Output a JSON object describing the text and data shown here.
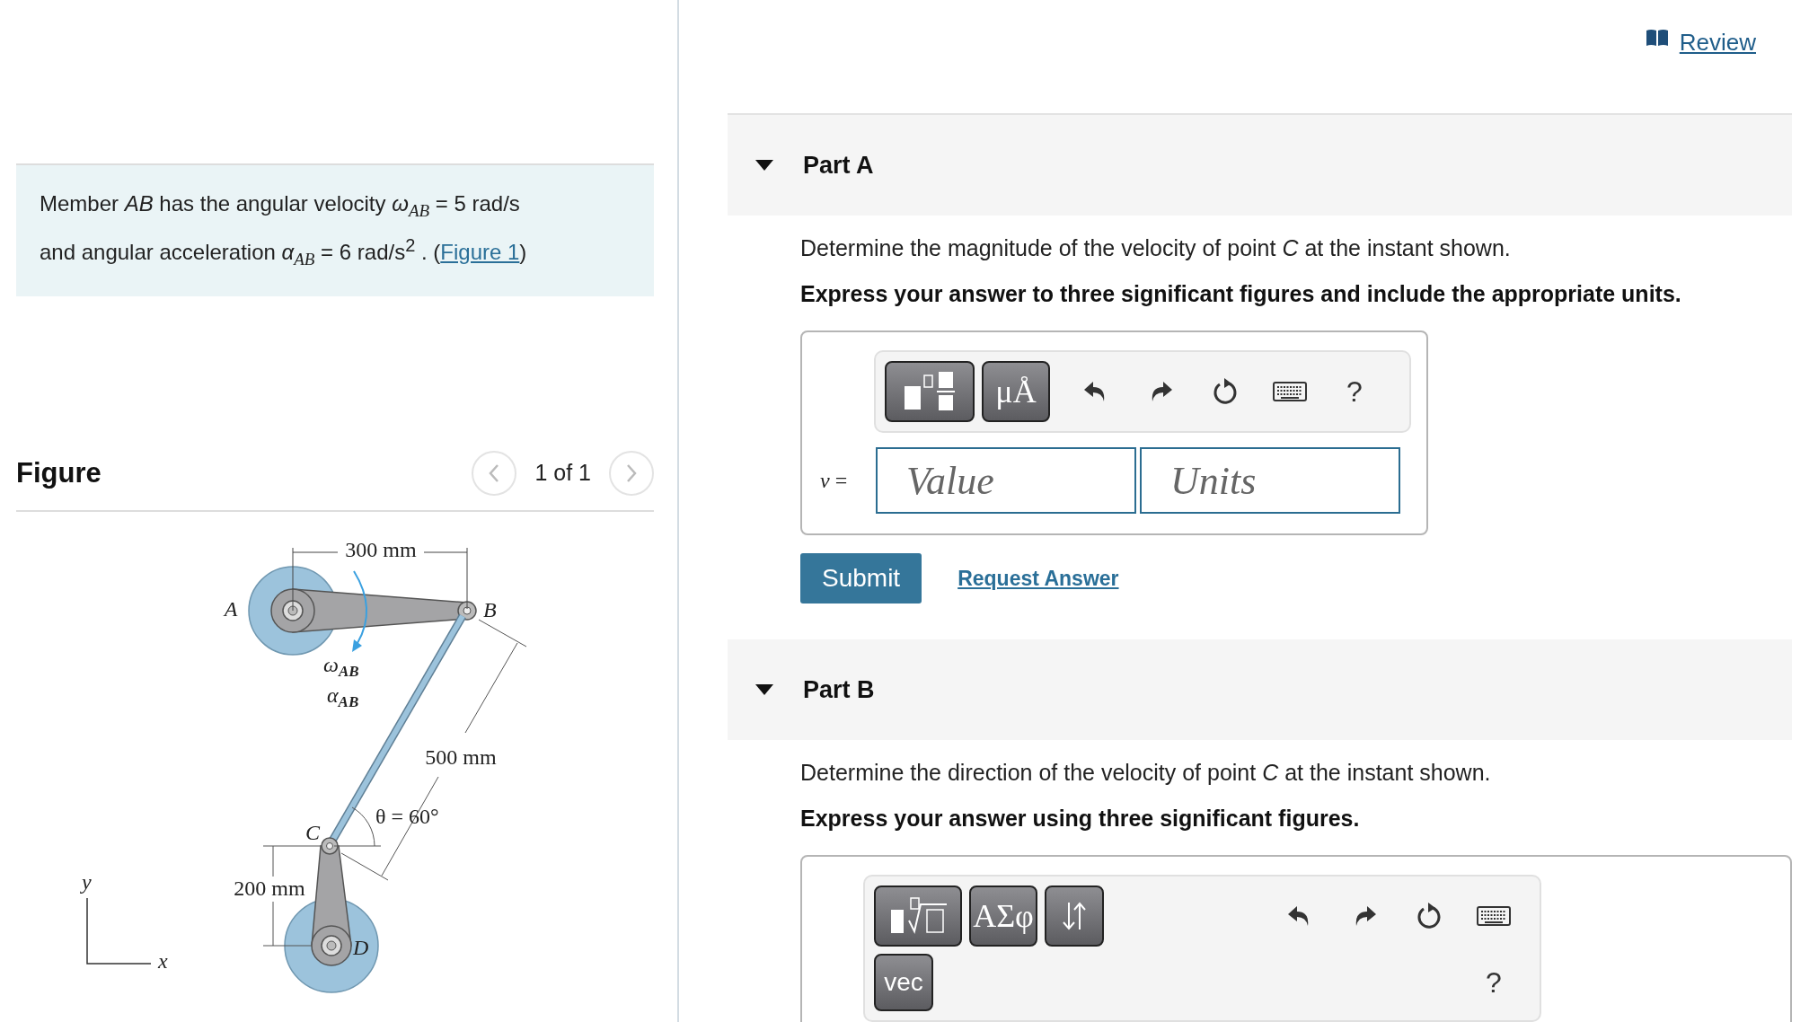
{
  "review_link": "Review",
  "problem": {
    "text": "Member *AB* has the angular velocity *ω*$_{AB}$ = 5  rad/s and angular acceleration *α*$_{AB}$ = 6  rad/s$^{2}$ . (",
    "link": "Figure 1",
    "text_end": ")"
  },
  "figure": {
    "title": "Figure",
    "pager": "1 of 1",
    "labels": [
      {
        "text": "300 mm"
      },
      {
        "text": "A"
      },
      {
        "text": "B"
      },
      {
        "text": "ω",
        "sub": "AB"
      },
      {
        "text": "α",
        "sub": "AB"
      },
      {
        "text": "500 mm"
      },
      {
        "text": "θ = 60°"
      },
      {
        "text": "C"
      },
      {
        "text": "200 mm"
      },
      {
        "text": "D"
      },
      {
        "text": "y"
      },
      {
        "text": "x"
      }
    ]
  },
  "parts": [
    {
      "title": "Part A",
      "expanded": true,
      "question": "Determine the magnitude of the velocity of point *C* at the instant shown.",
      "instruction": "Express your answer to three significant figures and include the appropriate units.",
      "toolbar_rows": [
        [
          {
            "kind": "template"
          },
          {
            "kind": "text",
            "label": "μÅ"
          },
          {
            "kind": "undo"
          },
          {
            "kind": "redo"
          },
          {
            "kind": "reset"
          },
          {
            "kind": "keyboard"
          },
          {
            "kind": "help",
            "label": "?"
          }
        ]
      ],
      "answer_label": "*v* =",
      "fields": [
        {
          "placeholder": "Value"
        },
        {
          "placeholder": "Units"
        }
      ],
      "submit": "Submit",
      "request": "Request Answer"
    },
    {
      "title": "Part B",
      "expanded": true,
      "question": "Determine the direction of the velocity of point *C* at the instant shown.",
      "instruction": "Express your answer using three significant figures.",
      "toolbar_rows": [
        [
          {
            "kind": "template_root"
          },
          {
            "kind": "text",
            "label": "ΑΣφ"
          },
          {
            "kind": "arrows"
          },
          {
            "kind": "undo"
          },
          {
            "kind": "redo"
          },
          {
            "kind": "reset"
          },
          {
            "kind": "keyboard"
          }
        ],
        [
          {
            "kind": "word",
            "label": "vec"
          },
          {
            "kind": "help",
            "label": "?"
          }
        ]
      ]
    }
  ]
}
